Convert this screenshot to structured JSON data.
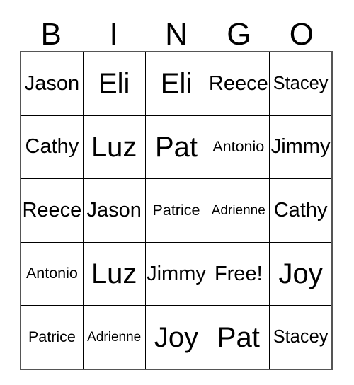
{
  "card": {
    "title": "BINGO",
    "free_space_label": "Free!",
    "text_color": "#000000",
    "background_color": "#ffffff",
    "border_color": "#000000",
    "outer_border_color": "#555555",
    "header": {
      "letters": [
        "B",
        "I",
        "N",
        "G",
        "O"
      ]
    },
    "grid": {
      "columns": 5,
      "rows": 5,
      "cells": [
        [
          {
            "label": "Jason"
          },
          {
            "label": "Eli"
          },
          {
            "label": "Eli"
          },
          {
            "label": "Reece"
          },
          {
            "label": "Stacey"
          }
        ],
        [
          {
            "label": "Cathy"
          },
          {
            "label": "Luz"
          },
          {
            "label": "Pat"
          },
          {
            "label": "Antonio"
          },
          {
            "label": "Jimmy"
          }
        ],
        [
          {
            "label": "Reece"
          },
          {
            "label": "Jason"
          },
          {
            "label": "Patrice"
          },
          {
            "label": "Adrienne"
          },
          {
            "label": "Cathy"
          }
        ],
        [
          {
            "label": "Antonio"
          },
          {
            "label": "Luz"
          },
          {
            "label": "Jimmy"
          },
          {
            "label": "Free!"
          },
          {
            "label": "Joy"
          }
        ],
        [
          {
            "label": "Patrice"
          },
          {
            "label": "Adrienne"
          },
          {
            "label": "Joy"
          },
          {
            "label": "Pat"
          },
          {
            "label": "Stacey"
          }
        ]
      ]
    }
  }
}
